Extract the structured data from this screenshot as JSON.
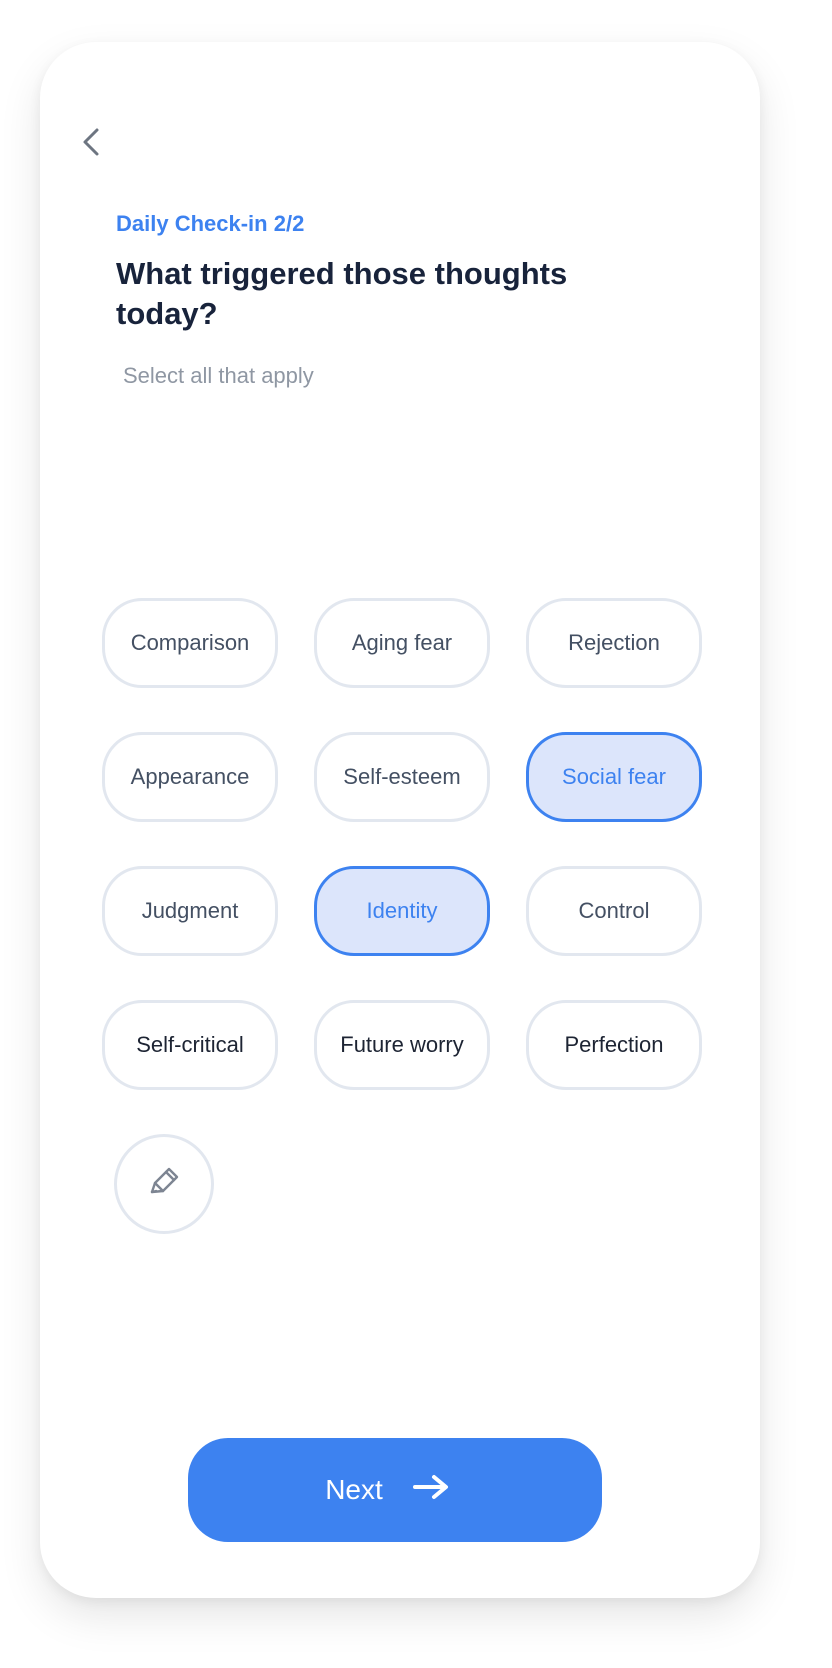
{
  "header": {
    "back_icon": "chevron-left-icon",
    "eyebrow": "Daily Check-in 2/2",
    "title": "What triggered those thoughts today?",
    "subtitle": "Select all that apply"
  },
  "chips": [
    {
      "label": "Comparison",
      "selected": false
    },
    {
      "label": "Aging fear",
      "selected": false
    },
    {
      "label": "Rejection",
      "selected": false
    },
    {
      "label": "Appearance",
      "selected": false
    },
    {
      "label": "Self-esteem",
      "selected": false
    },
    {
      "label": "Social fear",
      "selected": true
    },
    {
      "label": "Judgment",
      "selected": false
    },
    {
      "label": "Identity",
      "selected": true
    },
    {
      "label": "Control",
      "selected": false
    },
    {
      "label": "Self-critical",
      "selected": false
    },
    {
      "label": "Future worry",
      "selected": false
    },
    {
      "label": "Perfection",
      "selected": false
    }
  ],
  "edit_chip": {
    "icon": "pencil-icon"
  },
  "footer": {
    "next_label": "Next",
    "next_icon": "arrow-right-icon"
  },
  "colors": {
    "accent": "#3d82f0",
    "selected_fill": "#dce5fb",
    "chip_border": "#e2e7ef",
    "title_text": "#18233b",
    "muted_text": "#8f97a3"
  }
}
